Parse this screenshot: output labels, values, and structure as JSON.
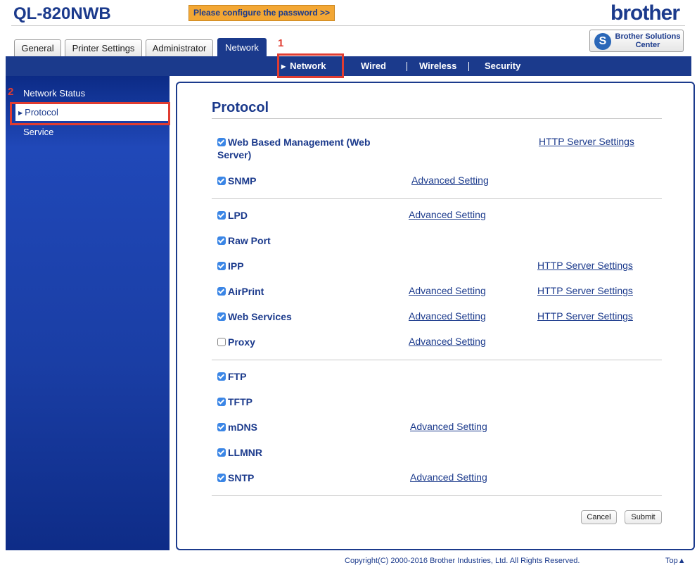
{
  "header": {
    "model": "QL-820NWB",
    "password_notice": "Please configure the password >>",
    "logo": "brother",
    "solutions_center": "Brother Solutions Center"
  },
  "tabs": [
    {
      "label": "General",
      "active": false
    },
    {
      "label": "Printer Settings",
      "active": false
    },
    {
      "label": "Administrator",
      "active": false
    },
    {
      "label": "Network",
      "active": true
    }
  ],
  "subnav": [
    {
      "label": "Network",
      "active": true
    },
    {
      "label": "Wired",
      "active": false
    },
    {
      "label": "Wireless",
      "active": false
    },
    {
      "label": "Security",
      "active": false
    }
  ],
  "annotations": {
    "one": "1",
    "two": "2",
    "color": "#e03c31"
  },
  "sidebar": {
    "items": [
      {
        "label": "Network Status",
        "selected": false
      },
      {
        "label": "Protocol",
        "selected": true
      },
      {
        "label": "Service",
        "selected": false
      }
    ]
  },
  "main": {
    "title": "Protocol",
    "protocols": [
      {
        "label": "Web Based Management (Web Server)",
        "checked": true,
        "advanced": "",
        "http": "HTTP Server Settings"
      },
      {
        "label": "SNMP",
        "checked": true,
        "advanced": "Advanced Setting",
        "http": ""
      },
      {
        "label": "LPD",
        "checked": true,
        "advanced": "Advanced Setting",
        "http": ""
      },
      {
        "label": "Raw Port",
        "checked": true,
        "advanced": "",
        "http": ""
      },
      {
        "label": "IPP",
        "checked": true,
        "advanced": "",
        "http": "HTTP Server Settings"
      },
      {
        "label": "AirPrint",
        "checked": true,
        "advanced": "Advanced Setting",
        "http": "HTTP Server Settings"
      },
      {
        "label": "Web Services",
        "checked": true,
        "advanced": "Advanced Setting",
        "http": "HTTP Server Settings"
      },
      {
        "label": "Proxy",
        "checked": false,
        "advanced": "Advanced Setting",
        "http": ""
      },
      {
        "label": "FTP",
        "checked": true,
        "advanced": "",
        "http": ""
      },
      {
        "label": "TFTP",
        "checked": true,
        "advanced": "",
        "http": ""
      },
      {
        "label": "mDNS",
        "checked": true,
        "advanced": "Advanced Setting",
        "http": ""
      },
      {
        "label": "LLMNR",
        "checked": true,
        "advanced": "",
        "http": ""
      },
      {
        "label": "SNTP",
        "checked": true,
        "advanced": "Advanced Setting",
        "http": ""
      }
    ],
    "cancel_label": "Cancel",
    "submit_label": "Submit"
  },
  "footer": {
    "copyright": "Copyright(C) 2000-2016 Brother Industries, Ltd. All Rights Reserved.",
    "top_link": "Top▲"
  },
  "colors": {
    "brand_blue": "#1b3a8c",
    "checkbox_blue": "#3b86e6",
    "notice_orange": "#f3a734"
  }
}
